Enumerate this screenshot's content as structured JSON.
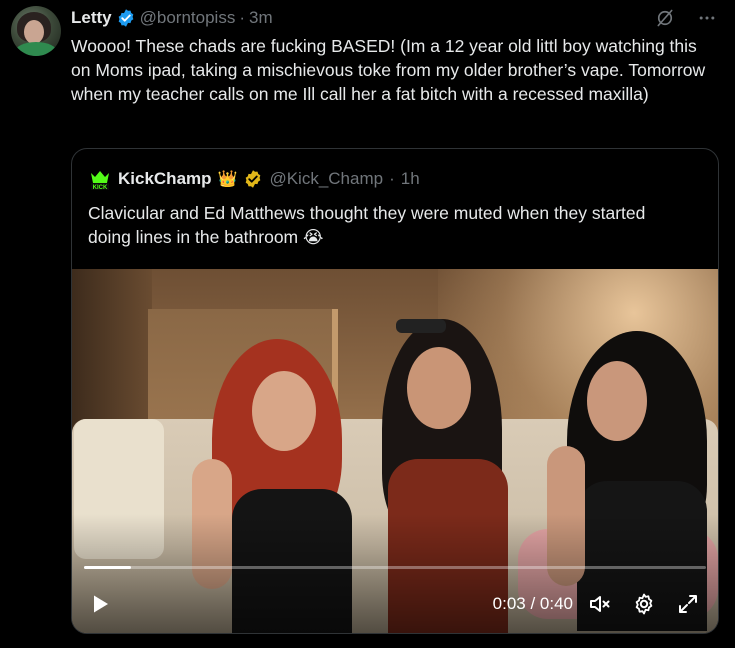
{
  "tweet": {
    "author_name": "Letty",
    "author_handle": "@borntopiss",
    "separator": "·",
    "time": "3m",
    "text": "Woooo! These chads are fucking BASED! (Im a 12 year old littl boy watching this on Moms ipad, taking a mischievous toke from my older brother’s vape. Tomorrow when my teacher calls on me Ill call her a fat bitch with a recessed maxilla)",
    "icons": {
      "grok": "grok-slash-icon",
      "more": "more-dots-icon",
      "verified": "verified-blue-badge-icon"
    }
  },
  "quote": {
    "logo_label": "KICK",
    "author_name": "KickChamp",
    "crown": "👑",
    "author_handle": "@Kick_Champ",
    "separator": "·",
    "time": "1h",
    "text": "Clavicular and Ed Matthews thought they were muted when they started doing lines in the bathroom 😭",
    "verified_icon": "verified-gold-badge-icon"
  },
  "video": {
    "current_time": "0:03",
    "duration": "0:40",
    "time_display": "0:03 / 0:40",
    "progress": 0.075,
    "icons": {
      "play": "play-icon",
      "mute": "muted-speaker-icon",
      "settings": "gear-icon",
      "fullscreen": "expand-icon"
    }
  },
  "colors": {
    "background": "#000000",
    "text": "#e7e9ea",
    "muted": "#71767b",
    "verified_blue": "#1d9bf0",
    "verified_gold": "#e2b719",
    "border": "#2f3336"
  }
}
